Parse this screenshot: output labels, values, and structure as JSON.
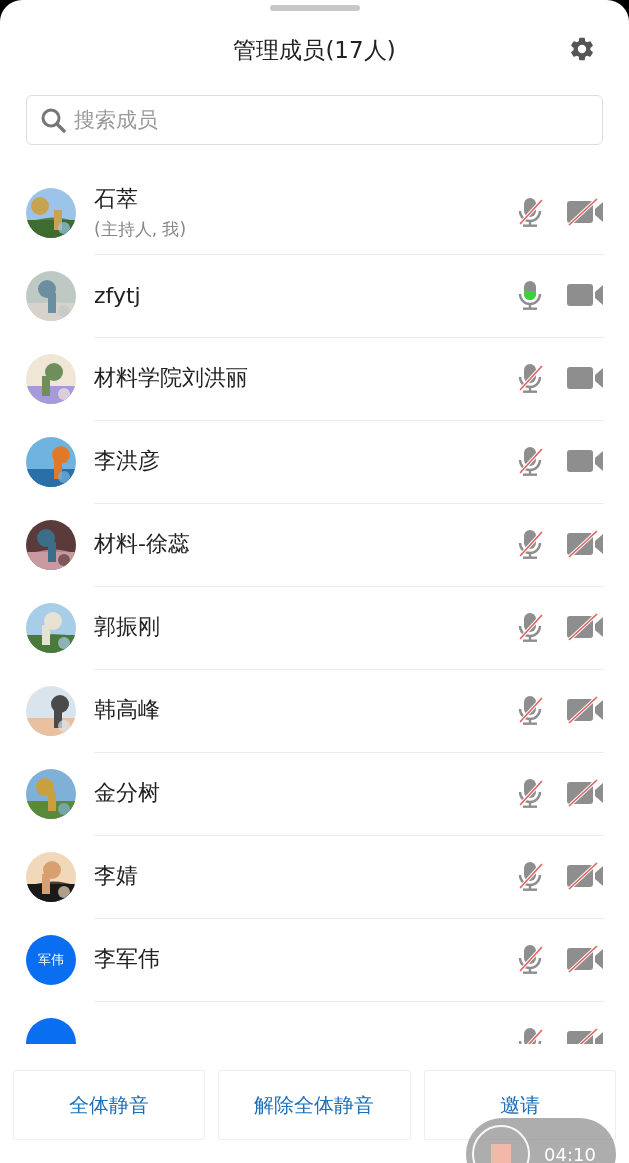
{
  "header": {
    "title": "管理成员(17人)"
  },
  "search": {
    "placeholder": "搜索成员"
  },
  "members": [
    {
      "name": "石萃",
      "subtitle": "(主持人, 我)",
      "mic_muted": true,
      "speaking": false,
      "camera_off": true
    },
    {
      "name": "zfytj",
      "mic_muted": false,
      "speaking": true,
      "camera_off": false
    },
    {
      "name": "材料学院刘洪丽",
      "mic_muted": true,
      "speaking": false,
      "camera_off": false
    },
    {
      "name": "李洪彦",
      "mic_muted": true,
      "speaking": false,
      "camera_off": false
    },
    {
      "name": "材料-徐蕊",
      "mic_muted": true,
      "speaking": false,
      "camera_off": true
    },
    {
      "name": "郭振刚",
      "mic_muted": true,
      "speaking": false,
      "camera_off": true
    },
    {
      "name": "韩高峰",
      "mic_muted": true,
      "speaking": false,
      "camera_off": true
    },
    {
      "name": "金分树",
      "mic_muted": true,
      "speaking": false,
      "camera_off": true
    },
    {
      "name": "李婧",
      "mic_muted": true,
      "speaking": false,
      "camera_off": true
    },
    {
      "name": "李军伟",
      "avatar": {
        "kind": "initials",
        "text": "军伟"
      },
      "mic_muted": true,
      "speaking": false,
      "camera_off": true
    },
    {
      "avatar": {
        "kind": "initials"
      },
      "mic_muted": true,
      "speaking": false,
      "camera_off": true
    }
  ],
  "actions": [
    "全体静音",
    "解除全体静音",
    "邀请"
  ],
  "recording": {
    "time": "04:10"
  }
}
